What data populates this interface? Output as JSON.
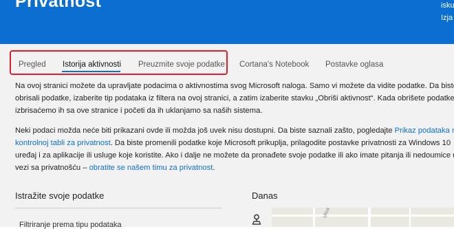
{
  "header": {
    "title": "Privatnost",
    "right_line1": "isku",
    "right_line2": "Izja"
  },
  "tabs": [
    {
      "label": "Pregled",
      "active": false
    },
    {
      "label": "Istorija aktivnosti",
      "active": true
    },
    {
      "label": "Preuzmite svoje podatke",
      "active": false
    },
    {
      "label": "Cortana's Notebook",
      "active": false
    },
    {
      "label": "Postavke oglasa",
      "active": false
    }
  ],
  "intro": {
    "line1": "Na ovoj stranici možete da upravljate podacima o aktivnostima svog Microsoft naloga. Samo vi možete da vidite podatke. Da biste",
    "line2": "obrisali podatke, izaberite tip podataka iz filtera na ovoj stranici, a zatim izaberite stavku „Obriši aktivnost“. Kada obrišete podatke,",
    "line3": "izbrisaćemo ih sa ove stranice i početi da ih uklanjamo sa naših sistema."
  },
  "notice": {
    "line1_text": "Neki podaci možda neće biti prikazani ovde ili možda još uvek nisu dostupni. Da biste saznali zašto, pogledajte ",
    "line1_link": "Prikaz podataka na",
    "line2_link": "kontrolnoj tabli za privatnost",
    "line2_text": ". Da biste promenili podatke koje Microsoft prikuplja, prilagodite postavke privatnosti za Windows 10",
    "line3": "uređaj i za aplikacije ili usluge koje koristite. Ako i dalje ne možete da pronađete svoje podatke ili ako imate pitanja ili nedoumice u",
    "line4_text": "vezi sa privatnošću – ",
    "line4_link": "obratite se našem timu za privatnost",
    "line4_end": "."
  },
  "sections": {
    "explore_title": "Istražite svoje podatke",
    "today_title": "Danas"
  },
  "filter_item": {
    "label": "Filtriranje prema tipu podataka"
  },
  "map": {
    "street_label": "Ulica"
  },
  "colors": {
    "header_blue": "#0a6fd1",
    "highlight_red": "#e11d2a",
    "link_blue": "#0a6fd1",
    "content_bg": "#f2f2f2"
  },
  "icons": {
    "location": "location-pin-icon"
  }
}
